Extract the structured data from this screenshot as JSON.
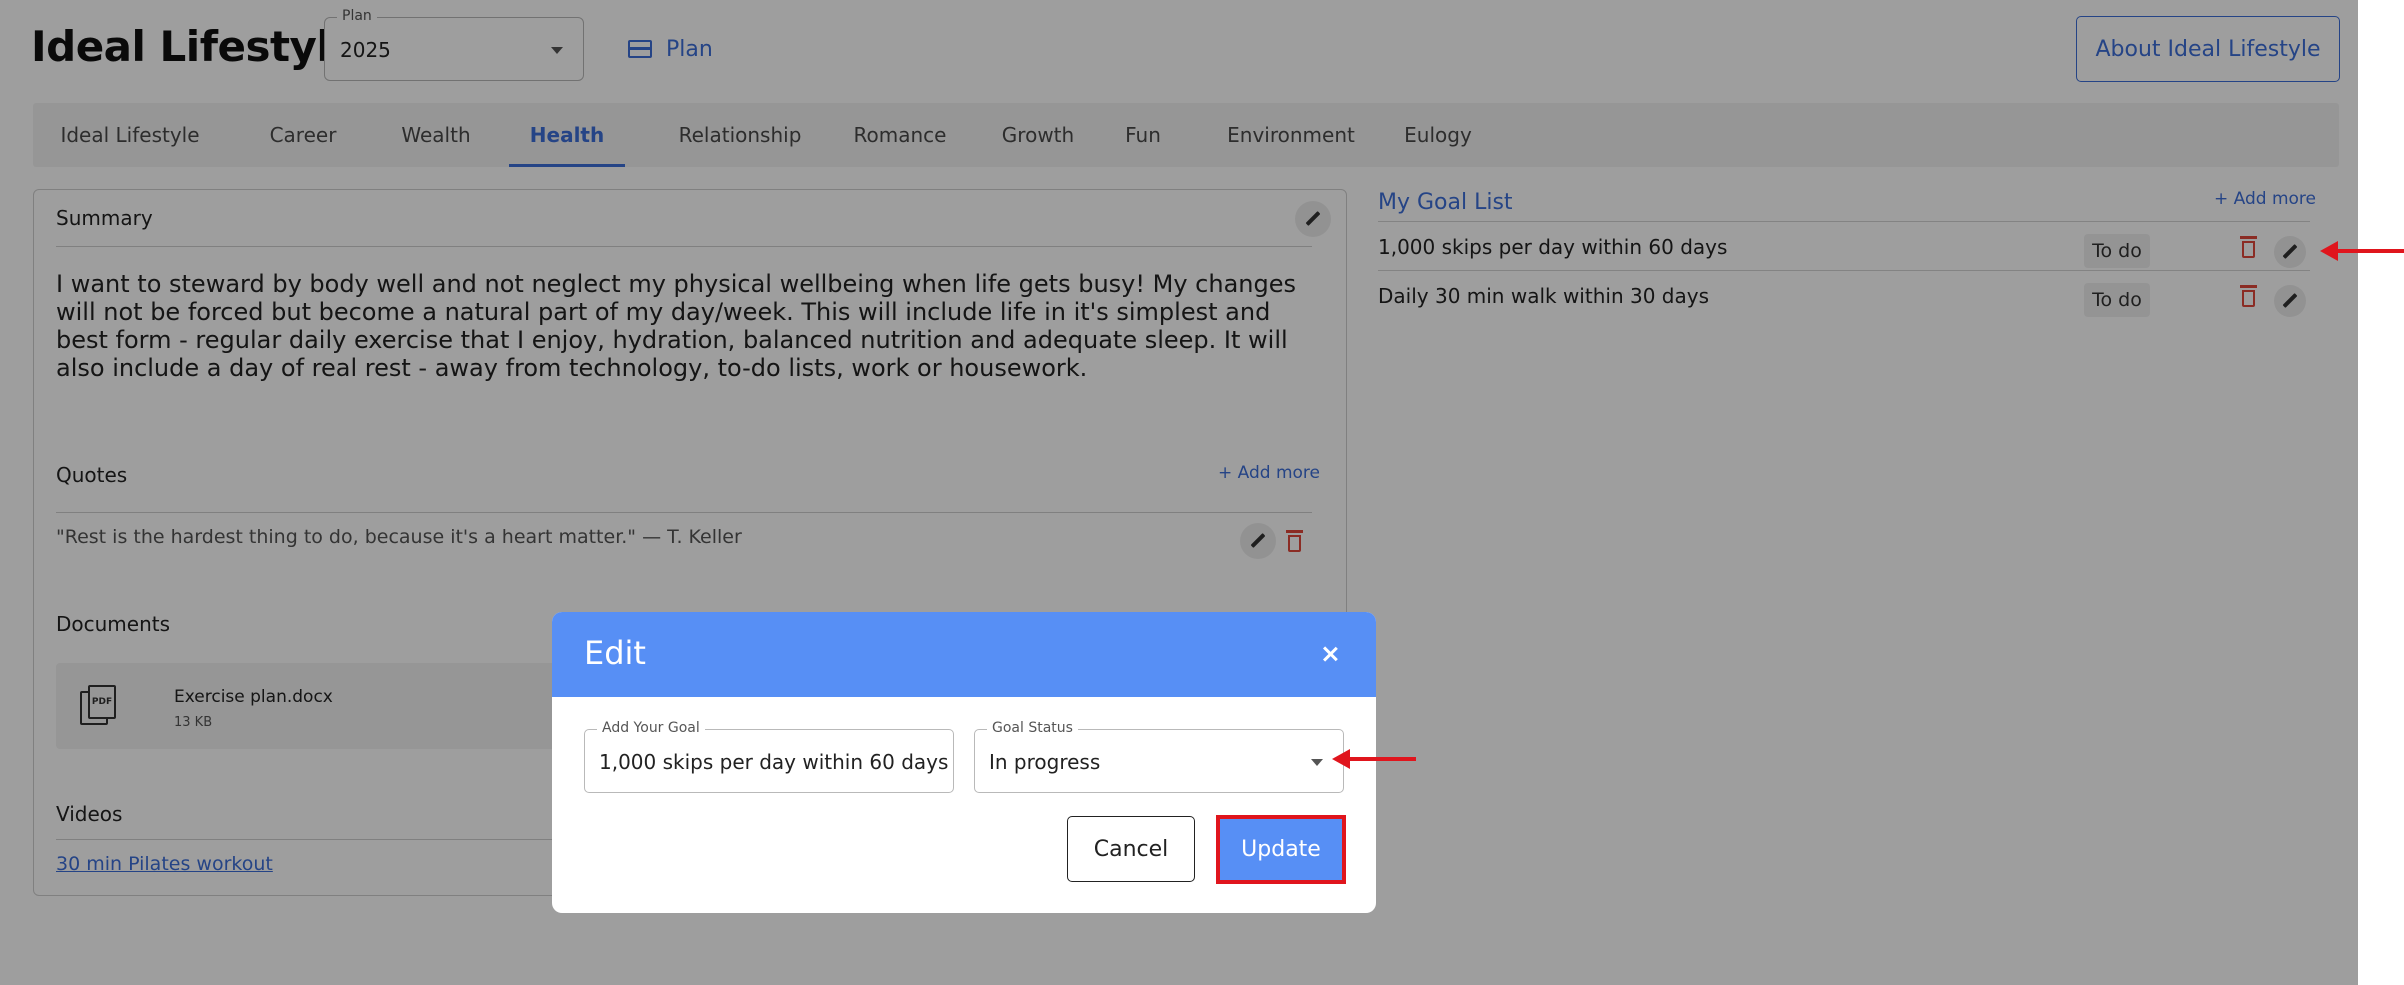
{
  "header": {
    "app_title": "Ideal Lifestyle",
    "plan_select": {
      "label": "Plan",
      "value": "2025"
    },
    "plan_link": "Plan",
    "about_button": "About Ideal Lifestyle"
  },
  "tabs": [
    {
      "label": "Ideal Lifestyle"
    },
    {
      "label": "Career"
    },
    {
      "label": "Wealth"
    },
    {
      "label": "Health",
      "active": true
    },
    {
      "label": "Relationship"
    },
    {
      "label": "Romance"
    },
    {
      "label": "Growth"
    },
    {
      "label": "Fun"
    },
    {
      "label": "Environment"
    },
    {
      "label": "Eulogy"
    }
  ],
  "summary": {
    "title": "Summary",
    "text": "I want to steward by body well and not neglect my physical wellbeing when life gets busy! My changes will not be forced but become a natural part of my day/week. This will include life in it's simplest and best form - regular daily exercise that I enjoy, hydration, balanced nutrition and adequate sleep. It will also include a day of real rest - away from technology, to-do lists, work or housework."
  },
  "quotes": {
    "title": "Quotes",
    "add_more": "+ Add more",
    "items": [
      "\"Rest is the hardest thing to do, because it's a heart matter.\" — T. Keller"
    ]
  },
  "documents": {
    "title": "Documents",
    "items": [
      {
        "name": "Exercise plan.docx",
        "size": "13 KB",
        "icon": "pdf-file-icon"
      }
    ]
  },
  "videos": {
    "title": "Videos",
    "items": [
      "30 min Pilates workout"
    ]
  },
  "goals": {
    "title": "My Goal List",
    "add_more": "+ Add more",
    "items": [
      {
        "text": "1,000 skips per day within 60 days",
        "status": "To do"
      },
      {
        "text": "Daily 30 min walk within 30 days",
        "status": "To do"
      }
    ]
  },
  "modal": {
    "title": "Edit",
    "goal_field": {
      "label": "Add Your Goal",
      "value": "1,000 skips per day within 60 days"
    },
    "status_field": {
      "label": "Goal Status",
      "value": "In progress"
    },
    "cancel": "Cancel",
    "update": "Update"
  },
  "colors": {
    "accent": "#3d6ed8",
    "modal_header": "#578ff5",
    "delete": "#e0483b",
    "annotation": "#e0151d"
  }
}
